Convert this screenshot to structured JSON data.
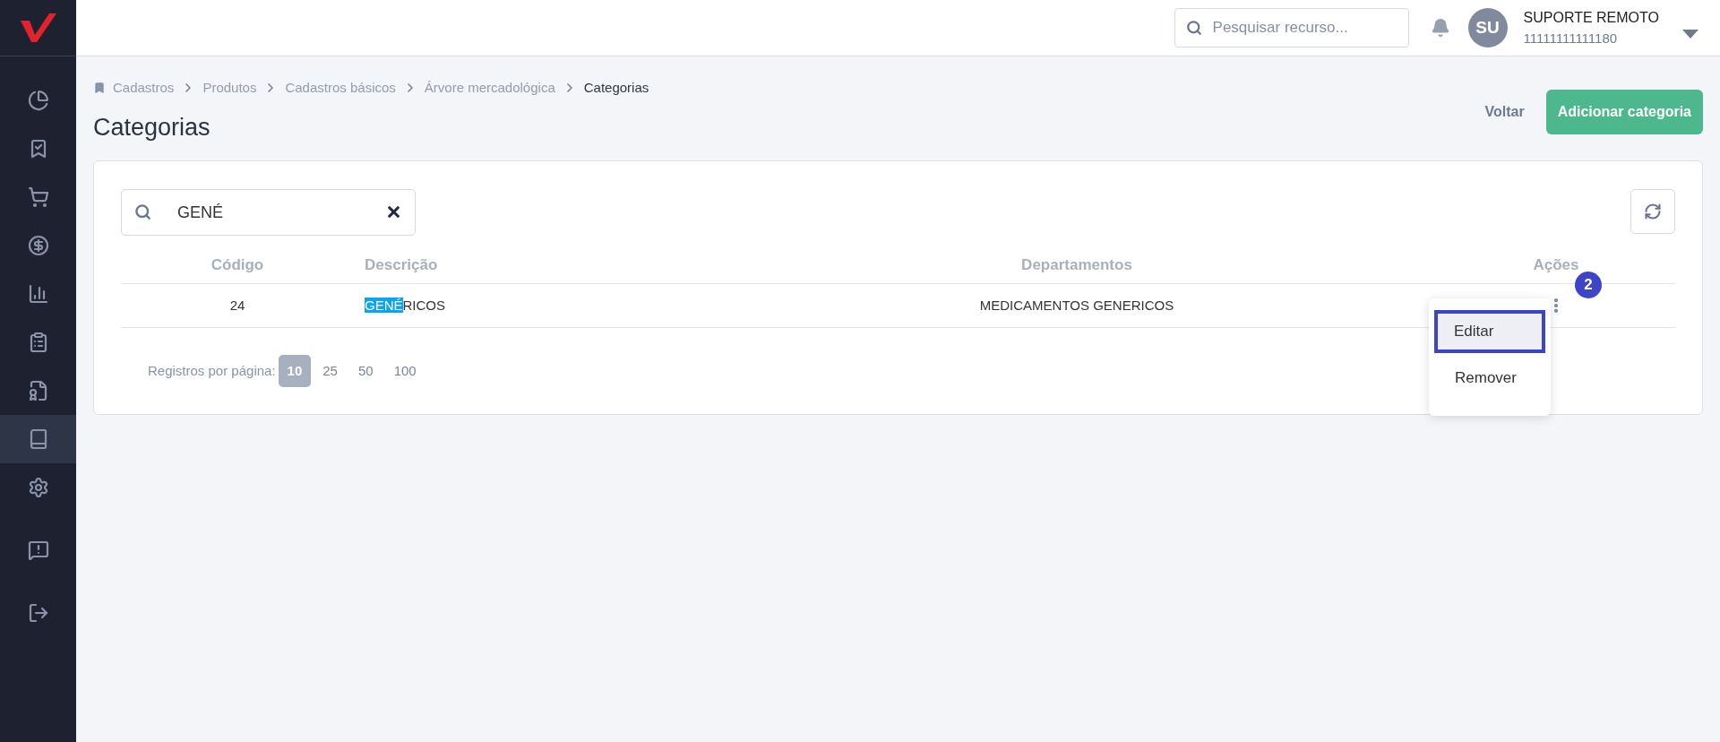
{
  "sidebar": {
    "items": [
      {
        "selected": false
      },
      {
        "selected": false
      },
      {
        "selected": false
      },
      {
        "selected": false
      },
      {
        "selected": false
      },
      {
        "selected": false
      },
      {
        "selected": false
      },
      {
        "selected": true
      },
      {
        "selected": false
      },
      {
        "selected": false
      },
      {
        "selected": false
      }
    ]
  },
  "header": {
    "search": {
      "placeholder": "Pesquisar recurso..."
    },
    "user": {
      "initials": "SU",
      "name": "SUPORTE REMOTO",
      "id": "11111111111180"
    }
  },
  "breadcrumb": [
    "Cadastros",
    "Produtos",
    "Cadastros básicos",
    "Árvore mercadológica",
    "Categorias"
  ],
  "page": {
    "title": "Categorias",
    "back": "Voltar",
    "add": "Adicionar categoria"
  },
  "filter": {
    "value": "GENÉ"
  },
  "table": {
    "columns": [
      "Código",
      "Descrição",
      "Departamentos",
      "Ações"
    ],
    "rows": [
      {
        "code": "24",
        "description_match": "GENÉ",
        "description_rest": "RICOS",
        "department": "MEDICAMENTOS GENERICOS"
      }
    ]
  },
  "pagination": {
    "label": "Registros por página:",
    "sizes": [
      {
        "label": "10",
        "selected": true
      },
      {
        "label": "25",
        "selected": false
      },
      {
        "label": "50",
        "selected": false
      },
      {
        "label": "100",
        "selected": false
      }
    ]
  },
  "menu": {
    "items": [
      {
        "label": "Editar",
        "selected": true
      },
      {
        "label": "Remover",
        "selected": false
      }
    ]
  },
  "step_badge": "2"
}
